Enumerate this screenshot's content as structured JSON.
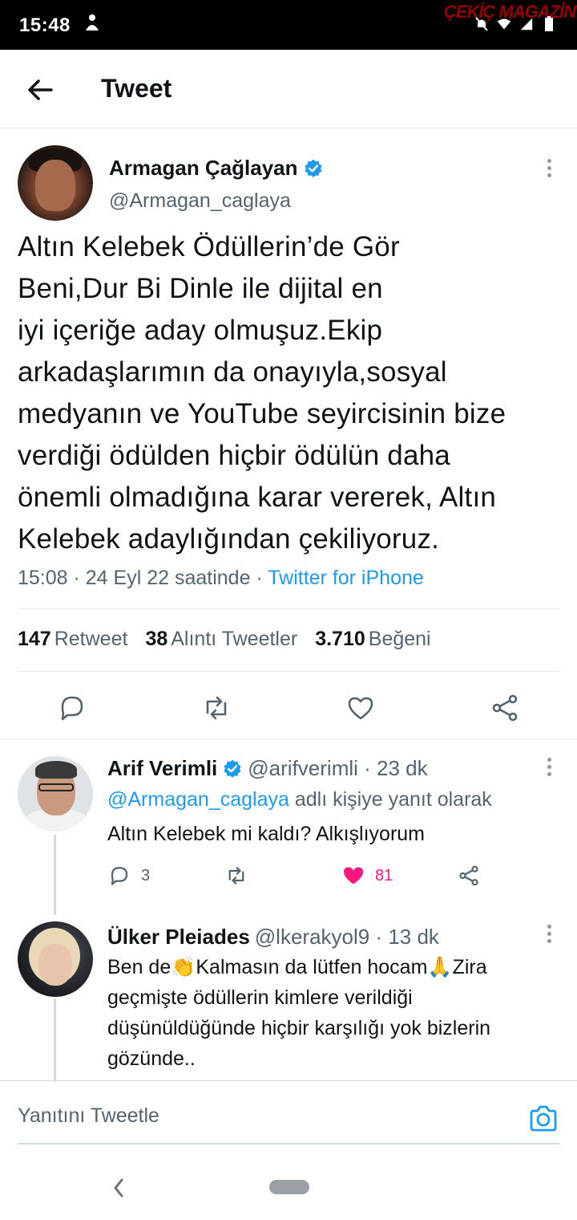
{
  "status_bar": {
    "time": "15:48",
    "watermark": "ÇEKİÇ MAGAZİN"
  },
  "header": {
    "title": "Tweet"
  },
  "tweet": {
    "name": "Armagan Çağlayan",
    "handle": "@Armagan_caglaya",
    "lines": [
      "Altın Kelebek Ödüllerin’de Gör",
      "Beni,Dur Bi Dinle ile dijital en",
      "iyi içeriğe aday olmuşuz.Ekip",
      "arkadaşlarımın da onayıyla,sosyal",
      "medyanın ve YouTube seyircisinin bize",
      "verdiği ödülden hiçbir ödülün daha",
      "önemli olmadığına karar vererek, Altın",
      "Kelebek adaylığından çekiliyoruz."
    ],
    "timestamp": "15:08 · 24 Eyl 22 saatinde · ",
    "source": "Twitter for iPhone",
    "stats": {
      "retweets": "147",
      "retweets_label": "Retweet",
      "quotes": "38",
      "quotes_label": "Alıntı Tweetler",
      "likes": "3.710",
      "likes_label": "Beğeni"
    }
  },
  "replies": [
    {
      "name": "Arif Verimli",
      "handle": "@arifverimli · 23 dk",
      "replying_mention": "@Armagan_caglaya",
      "replying_suffix": " adlı kişiye yanıt olarak",
      "lines": [
        "Altın Kelebek mi kaldı? Alkışlıyorum"
      ],
      "reply_count": "3",
      "like_count": "81"
    },
    {
      "name": "Ülker Pleiades",
      "handle": "@lkerakyol9 · 13 dk",
      "lines": [
        "Ben de👏Kalmasın da lütfen hocam🙏Zira",
        "geçmişte ödüllerin kimlere verildiği",
        "düşünüldüğünde hiçbir karşılığı yok bizlerin",
        "gözünde.."
      ]
    }
  ],
  "reply_bar": {
    "placeholder": "Yanıtını Tweetle"
  },
  "colors": {
    "accent": "#1d9bf0",
    "like": "#f91880",
    "muted": "#536471"
  }
}
